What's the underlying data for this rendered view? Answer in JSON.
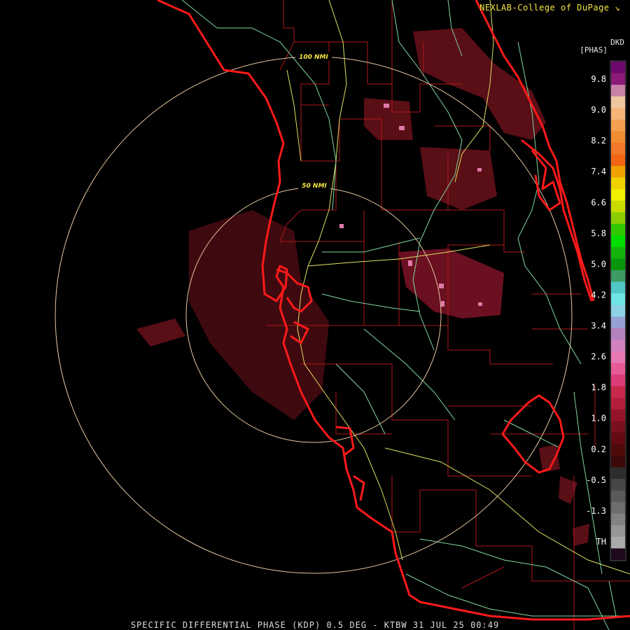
{
  "credit": "NEXLAB-College of DuPage",
  "credit_icon": "corner-arrow-icon",
  "legend": {
    "unit_top": "DKD",
    "unit_bottom": "[PHAS]",
    "ticks": [
      "9.8",
      "9.0",
      "8.2",
      "7.4",
      "6.6",
      "5.8",
      "5.0",
      "4.2",
      "3.4",
      "2.6",
      "1.8",
      "1.0",
      "0.2",
      "-0.5",
      "-1.3",
      "TH"
    ],
    "colors": [
      "#6e0a6e",
      "#8c1a78",
      "#c882a8",
      "#f0c8a0",
      "#f5b478",
      "#f5a050",
      "#f08c32",
      "#f07828",
      "#f06414",
      "#f0a000",
      "#f0d200",
      "#f0f000",
      "#c8dc00",
      "#8ccc00",
      "#32c800",
      "#00dc00",
      "#14b40a",
      "#0a960a",
      "#3c9c64",
      "#50c8c8",
      "#6ee6e6",
      "#8cd2e6",
      "#96a0d2",
      "#b482be",
      "#d282be",
      "#e678b4",
      "#e65a96",
      "#dc3c78",
      "#c8284b",
      "#b41e3c",
      "#961428",
      "#78101e",
      "#640a14",
      "#500a0a",
      "#3c0a0a",
      "#2d2d2d",
      "#464646",
      "#5a5a5a",
      "#6e6e6e",
      "#828282",
      "#969696",
      "#aaaaaa",
      "#1e0a1e"
    ],
    "colors_note": ""
  },
  "rings": [
    {
      "label": "50 NMI"
    },
    {
      "label": "100 NMI"
    }
  ],
  "caption": "SPECIFIC DIFFERENTIAL PHASE (KDP) 0.5 DEG - KTBW 31 JUL 25 00:49",
  "palette": {
    "coast": "#ff1a1a",
    "county": "#b01818",
    "highway_yellow": "#e0e060",
    "highway_green": "#7fd6a0",
    "ring": "#e8c8a0",
    "echo_dark": "#5a0e16",
    "echo_mid": "#7a1424",
    "echo_light": "#e07aaa"
  }
}
